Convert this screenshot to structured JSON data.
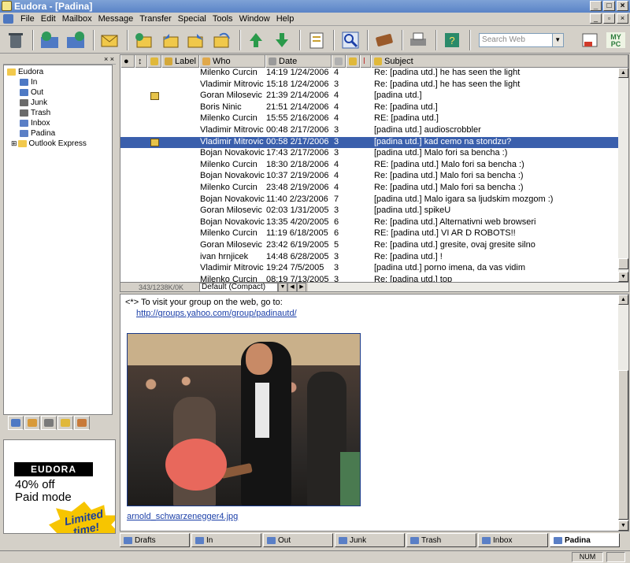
{
  "window": {
    "title": "Eudora - [Padina]"
  },
  "menu": [
    "File",
    "Edit",
    "Mailbox",
    "Message",
    "Transfer",
    "Special",
    "Tools",
    "Window",
    "Help"
  ],
  "toolbar": {
    "search_placeholder": "Search Web"
  },
  "tree": {
    "items": [
      {
        "label": "Eudora",
        "icon": "folder-icon",
        "indent": 0
      },
      {
        "label": "In",
        "icon": "in-mailbox-icon",
        "indent": 1
      },
      {
        "label": "Out",
        "icon": "out-mailbox-icon",
        "indent": 1
      },
      {
        "label": "Junk",
        "icon": "junk-icon",
        "indent": 1
      },
      {
        "label": "Trash",
        "icon": "trash-icon",
        "indent": 1
      },
      {
        "label": "Inbox",
        "icon": "mailbox-icon",
        "indent": 1
      },
      {
        "label": "Padina",
        "icon": "mailbox-icon",
        "indent": 1
      },
      {
        "label": "Outlook Express",
        "icon": "folder-icon",
        "indent": 1
      }
    ]
  },
  "ad": {
    "logo": "EUDORA",
    "line1": "40% off",
    "line2": "Paid mode",
    "burst1": "Limited",
    "burst2": "time!"
  },
  "columns": {
    "label": "Label",
    "who": "Who",
    "date": "Date",
    "subject": "Subject"
  },
  "messages": [
    {
      "who": "Milenko Curcin",
      "date": "14:19 1/24/2006",
      "size": "4",
      "subject": "Re: [padina utd.] he has seen the light",
      "attach": false,
      "selected": false
    },
    {
      "who": "Vladimir Mitrovic",
      "date": "15:18 1/24/2006",
      "size": "3",
      "subject": "Re: [padina utd.] he has seen the light",
      "attach": false,
      "selected": false
    },
    {
      "who": "Goran Milosevic",
      "date": "21:39 2/14/2006",
      "size": "4",
      "subject": "[padina utd.]",
      "attach": true,
      "selected": false
    },
    {
      "who": "Boris Ninic",
      "date": "21:51 2/14/2006",
      "size": "4",
      "subject": "Re: [padina utd.]",
      "attach": false,
      "selected": false
    },
    {
      "who": "Milenko Curcin",
      "date": "15:55 2/16/2006",
      "size": "4",
      "subject": "RE: [padina utd.]",
      "attach": false,
      "selected": false
    },
    {
      "who": "Vladimir Mitrovic",
      "date": "00:48 2/17/2006",
      "size": "3",
      "subject": "[padina utd.] audioscrobbler",
      "attach": false,
      "selected": false
    },
    {
      "who": "Vladimir Mitrovic",
      "date": "00:58 2/17/2006",
      "size": "3",
      "subject": "[padina utd.] kad cemo na stondzu?",
      "attach": true,
      "selected": true
    },
    {
      "who": "Bojan Novakovic",
      "date": "17:43 2/17/2006",
      "size": "3",
      "subject": "[padina utd.] Malo fori sa bencha :)",
      "attach": false,
      "selected": false
    },
    {
      "who": "Milenko Curcin",
      "date": "18:30 2/18/2006",
      "size": "4",
      "subject": "RE: [padina utd.] Malo fori sa bencha :)",
      "attach": false,
      "selected": false
    },
    {
      "who": "Bojan Novakovic",
      "date": "10:37 2/19/2006",
      "size": "4",
      "subject": "Re: [padina utd.] Malo fori sa bencha :)",
      "attach": false,
      "selected": false
    },
    {
      "who": "Milenko Curcin",
      "date": "23:48 2/19/2006",
      "size": "4",
      "subject": "Re: [padina utd.] Malo fori sa bencha :)",
      "attach": false,
      "selected": false
    },
    {
      "who": "Bojan Novakovic",
      "date": "11:40 2/23/2006",
      "size": "7",
      "subject": "[padina utd.] Malo igara sa ljudskim mozgom :)",
      "attach": false,
      "selected": false
    },
    {
      "who": "Goran Milosevic",
      "date": "02:03 1/31/2005",
      "size": "3",
      "subject": "[padina utd.] spikeU",
      "attach": false,
      "selected": false
    },
    {
      "who": "Bojan Novakovic",
      "date": "13:35 4/20/2005",
      "size": "6",
      "subject": "Re: [padina utd.] Alternativni web browseri",
      "attach": false,
      "selected": false
    },
    {
      "who": "Milenko Curcin",
      "date": "11:19 6/18/2005",
      "size": "6",
      "subject": "RE: [padina utd.] VI AR D ROBOTS!!",
      "attach": false,
      "selected": false
    },
    {
      "who": "Goran Milosevic",
      "date": "23:42 6/19/2005",
      "size": "5",
      "subject": "Re: [padina utd.] gresite, ovaj gresite silno",
      "attach": false,
      "selected": false
    },
    {
      "who": "ivan hrnjicek",
      "date": "14:48 6/28/2005",
      "size": "3",
      "subject": "Re: [padina utd.] !",
      "attach": false,
      "selected": false
    },
    {
      "who": "Vladimir Mitrovic",
      "date": "19:24 7/5/2005",
      "size": "3",
      "subject": "[padina utd.] porno imena, da vas vidim",
      "attach": false,
      "selected": false
    },
    {
      "who": "Milenko Curcin",
      "date": "08:19 7/13/2005",
      "size": "3",
      "subject": "Re: [padina utd.] top",
      "attach": false,
      "selected": false
    }
  ],
  "list_status": {
    "count": "343/1238K/0K",
    "view": "Default (Compact)"
  },
  "preview": {
    "intro": "<*> To visit your group on the web, go to:",
    "link": "http://groups.yahoo.com/group/padinautd/",
    "filename": "arnold_schwarzenegger4.jpg"
  },
  "mailbox_tabs": [
    {
      "label": "Drafts",
      "active": false
    },
    {
      "label": "In",
      "active": false
    },
    {
      "label": "Out",
      "active": false
    },
    {
      "label": "Junk",
      "active": false
    },
    {
      "label": "Trash",
      "active": false
    },
    {
      "label": "Inbox",
      "active": false
    },
    {
      "label": "Padina",
      "active": true
    }
  ],
  "status": {
    "num": "NUM"
  },
  "colors": {
    "selection": "#3a5fac",
    "link": "#1b3fa8",
    "title_bar": "#5a83c7"
  }
}
